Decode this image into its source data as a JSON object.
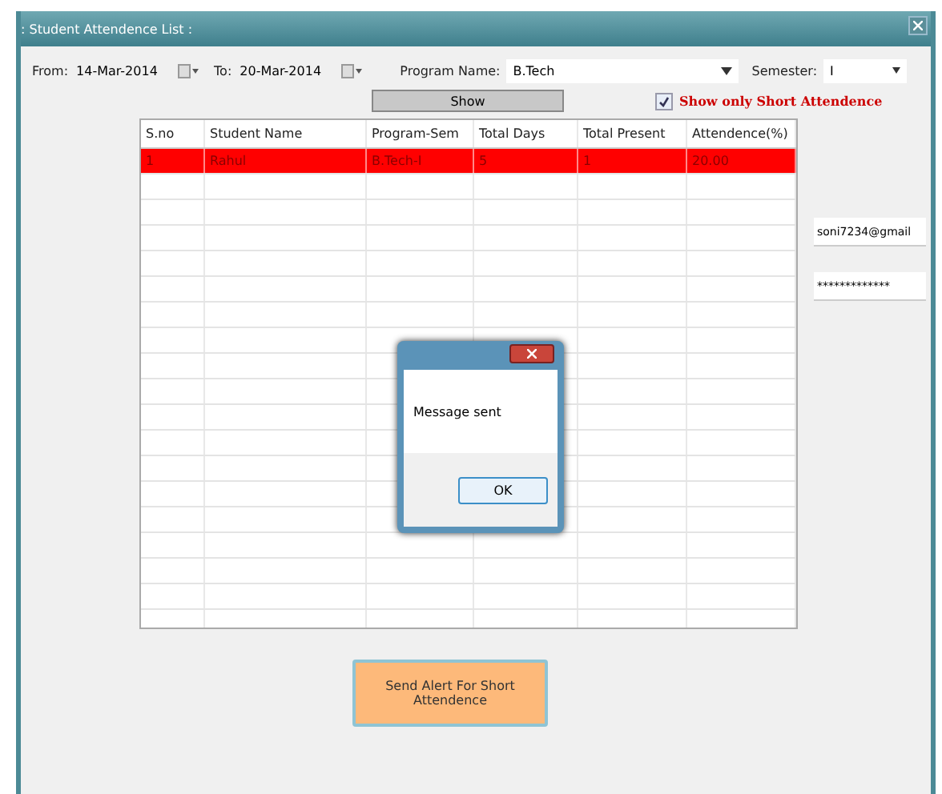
{
  "window": {
    "title": ": Student Attendence List :"
  },
  "filters": {
    "from_label": "From:",
    "from_date": "14-Mar-2014",
    "to_label": "To:",
    "to_date": "20-Mar-2014",
    "program_label": "Program Name:",
    "program": "B.Tech",
    "semester_label": "Semester:",
    "semester": "I"
  },
  "show_button": "Show",
  "short_only": {
    "label": "Show only Short Attendence",
    "checked": true
  },
  "table": {
    "columns": [
      "S.no",
      "Student Name",
      "Program-Sem",
      "Total Days",
      "Total Present",
      "Attendence(%)"
    ],
    "rows": [
      {
        "cells": [
          "1",
          "Rahul",
          "B.Tech-I",
          "5",
          "1",
          "20.00"
        ],
        "highlighted": true
      }
    ]
  },
  "email_field": {
    "value": "soni7234@gmail"
  },
  "password_field": {
    "value": "*************"
  },
  "alert_button": "Send Alert For Short Attendence",
  "dialog": {
    "message": "Message sent",
    "button": "OK"
  }
}
